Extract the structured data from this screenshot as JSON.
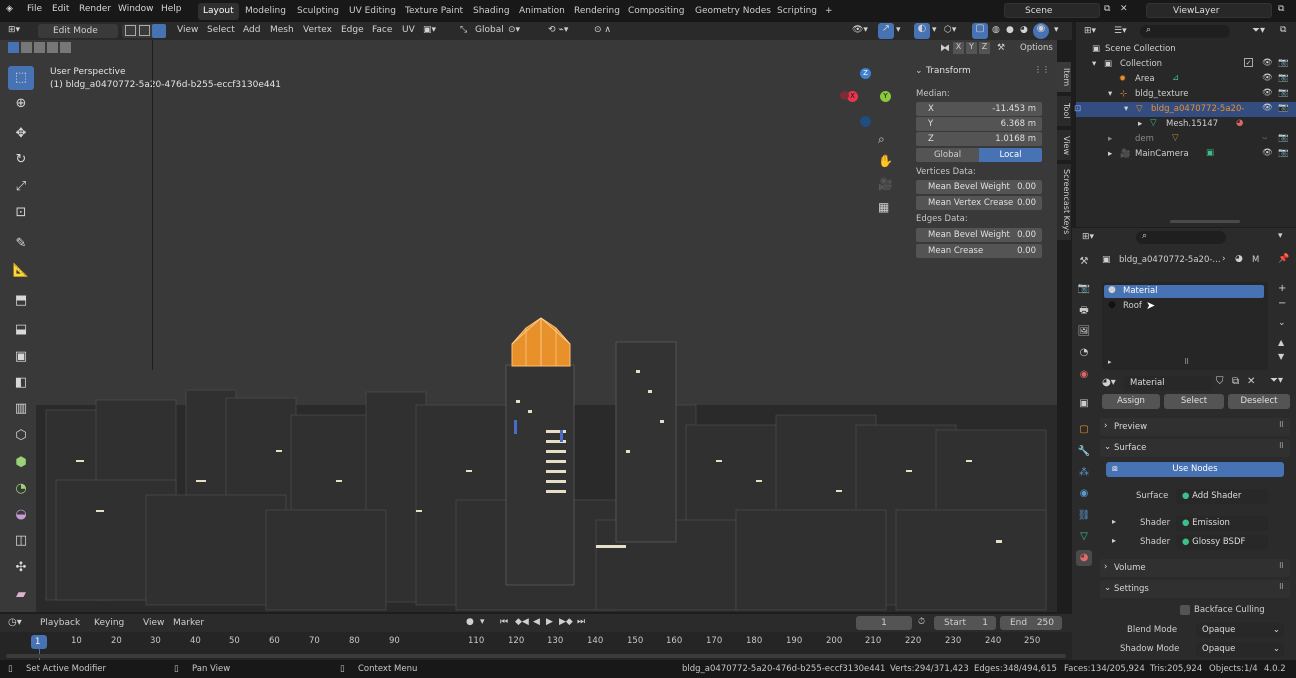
{
  "topbar": {
    "menus": [
      "File",
      "Edit",
      "Render",
      "Window",
      "Help"
    ],
    "workspaces": [
      "Layout",
      "Modeling",
      "Sculpting",
      "UV Editing",
      "Texture Paint",
      "Shading",
      "Animation",
      "Rendering",
      "Compositing",
      "Geometry Nodes",
      "Scripting"
    ],
    "active_workspace": "Layout",
    "add_tab": "+",
    "scene": "Scene",
    "view_layer": "ViewLayer"
  },
  "viewport_header": {
    "mode": "Edit Mode",
    "menus": [
      "View",
      "Select",
      "Add",
      "Mesh",
      "Vertex",
      "Edge",
      "Face",
      "UV"
    ],
    "orientation": "Global",
    "options": "Options",
    "axes": [
      "X",
      "Y",
      "Z"
    ]
  },
  "viewport": {
    "perspective": "User Perspective",
    "object_info": "(1) bldg_a0470772-5a20-476d-b255-eccf3130e441",
    "gizmo": {
      "z": "Z",
      "y": "Y",
      "x": "X"
    }
  },
  "npanel": {
    "title": "Transform",
    "median": "Median:",
    "x_label": "X",
    "x_value": "-11.453 m",
    "y_label": "Y",
    "y_value": "6.368 m",
    "z_label": "Z",
    "z_value": "1.0168 m",
    "global": "Global",
    "local": "Local",
    "vertices_data": "Vertices Data:",
    "mean_bevel_weight": "Mean Bevel Weight",
    "mbw_value": "0.00",
    "mean_vertex_crease": "Mean Vertex Crease",
    "mvc_value": "0.00",
    "edges_data": "Edges Data:",
    "edge_bevel_weight": "Mean Bevel Weight",
    "ebw_value": "0.00",
    "mean_crease": "Mean Crease",
    "mc_value": "0.00",
    "tabs": [
      "Item",
      "Tool",
      "View",
      "Screencast Keys"
    ]
  },
  "outliner": {
    "root": "Scene Collection",
    "items": [
      {
        "label": "Collection"
      },
      {
        "label": "Area"
      },
      {
        "label": "bldg_texture"
      },
      {
        "label": "bldg_a0470772-5a20-"
      },
      {
        "label": "Mesh.15147"
      },
      {
        "label": "dem"
      },
      {
        "label": "MainCamera"
      }
    ]
  },
  "properties": {
    "breadcrumb": "bldg_a0470772-5a20-...",
    "breadcrumb_end": "M",
    "slots": [
      "Material",
      "Roof"
    ],
    "material_name": "Material",
    "assign": "Assign",
    "select": "Select",
    "deselect": "Deselect",
    "preview": "Preview",
    "surface": "Surface",
    "use_nodes": "Use Nodes",
    "surface_label": "Surface",
    "surface_value": "Add Shader",
    "shader1_label": "Shader",
    "shader1_value": "Emission",
    "shader2_label": "Shader",
    "shader2_value": "Glossy BSDF",
    "volume": "Volume",
    "settings": "Settings",
    "backface_culling": "Backface Culling",
    "blend_mode_label": "Blend Mode",
    "blend_mode_value": "Opaque",
    "shadow_mode_label": "Shadow Mode",
    "shadow_mode_value": "Opaque"
  },
  "timeline": {
    "menus": [
      "Playback",
      "Keying",
      "View",
      "Marker"
    ],
    "current_frame": "1",
    "start_label": "Start",
    "start_value": "1",
    "end_label": "End",
    "end_value": "250",
    "ticks": [
      "1",
      "10",
      "20",
      "30",
      "40",
      "50",
      "60",
      "70",
      "80",
      "90",
      "110",
      "120",
      "130",
      "140",
      "150",
      "160",
      "170",
      "180",
      "190",
      "200",
      "210",
      "220",
      "230",
      "240",
      "250"
    ]
  },
  "statusbar": {
    "left1": "Set Active Modifier",
    "left2": "Pan View",
    "left3": "Context Menu",
    "stats_object": "bldg_a0470772-5a20-476d-b255-eccf3130e441",
    "verts": "Verts:294/371,423",
    "edges": "Edges:348/494,615",
    "faces": "Faces:134/205,924",
    "tris": "Tris:205,924",
    "objects": "Objects:1/4",
    "version": "4.0.2"
  },
  "colors": {
    "accent": "#4772b3",
    "selection": "#e8902a",
    "gizmo_x": "#e8364e",
    "gizmo_y": "#8bc83b",
    "gizmo_z": "#3d83cf"
  }
}
